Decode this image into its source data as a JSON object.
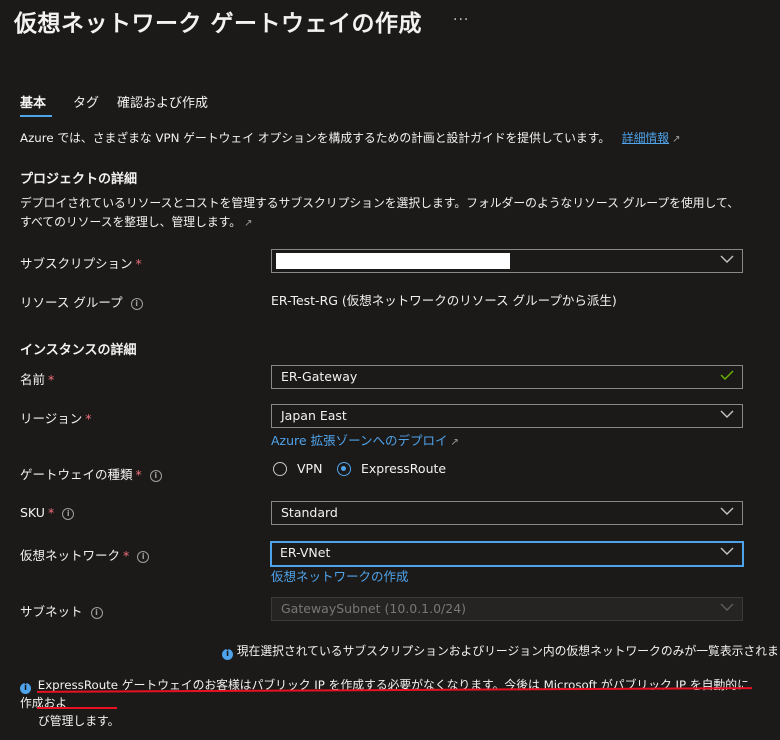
{
  "page": {
    "title": "仮想ネットワーク ゲートウェイの作成",
    "more": "···"
  },
  "tabs": [
    {
      "label": "基本",
      "active": true
    },
    {
      "label": "タグ",
      "active": false
    },
    {
      "label": "確認および作成",
      "active": false
    }
  ],
  "intro": {
    "text": "Azure では、さまざまな VPN ゲートウェイ オプションを構成するための計画と設計ガイドを提供しています。",
    "link": "詳細情報"
  },
  "project": {
    "heading": "プロジェクトの詳細",
    "description": "デプロイされているリソースとコストを管理するサブスクリプションを選択します。フォルダーのようなリソース グループを使用して、すべてのリソースを整理し、管理します。",
    "subscription_label": "サブスクリプション",
    "subscription_value": "",
    "resource_group_label": "リソース グループ",
    "resource_group_value": "ER-Test-RG (仮想ネットワークのリソース グループから派生)"
  },
  "instance": {
    "heading": "インスタンスの詳細",
    "name_label": "名前",
    "name_value": "ER-Gateway",
    "region_label": "リージョン",
    "region_value": "Japan East",
    "region_link": "Azure 拡張ゾーンへのデプロイ",
    "gateway_type_label": "ゲートウェイの種類",
    "gateway_type_options": [
      "VPN",
      "ExpressRoute"
    ],
    "gateway_type_selected": "ExpressRoute",
    "sku_label": "SKU",
    "sku_value": "Standard",
    "vnet_label": "仮想ネットワーク",
    "vnet_value": "ER-VNet",
    "vnet_link": "仮想ネットワークの作成",
    "subnet_label": "サブネット",
    "subnet_value": "GatewaySubnet (10.0.1.0/24)"
  },
  "notes": {
    "vnet_note": "現在選択されているサブスクリプションおよびリージョン内の仮想ネットワークのみが一覧表示されます。",
    "public_ip_note_line1": "ExpressRoute ゲートウェイのお客様はパブリック IP を作成する必要がなくなります。今後は Microsoft がパブリック IP を自動的に作成およ",
    "public_ip_note_line2": "び管理します。"
  },
  "colors": {
    "background": "#1b1a19",
    "accent": "#4fa3ea",
    "required": "#f1707b",
    "valid": "#6bb700",
    "annotation": "#e81123"
  }
}
